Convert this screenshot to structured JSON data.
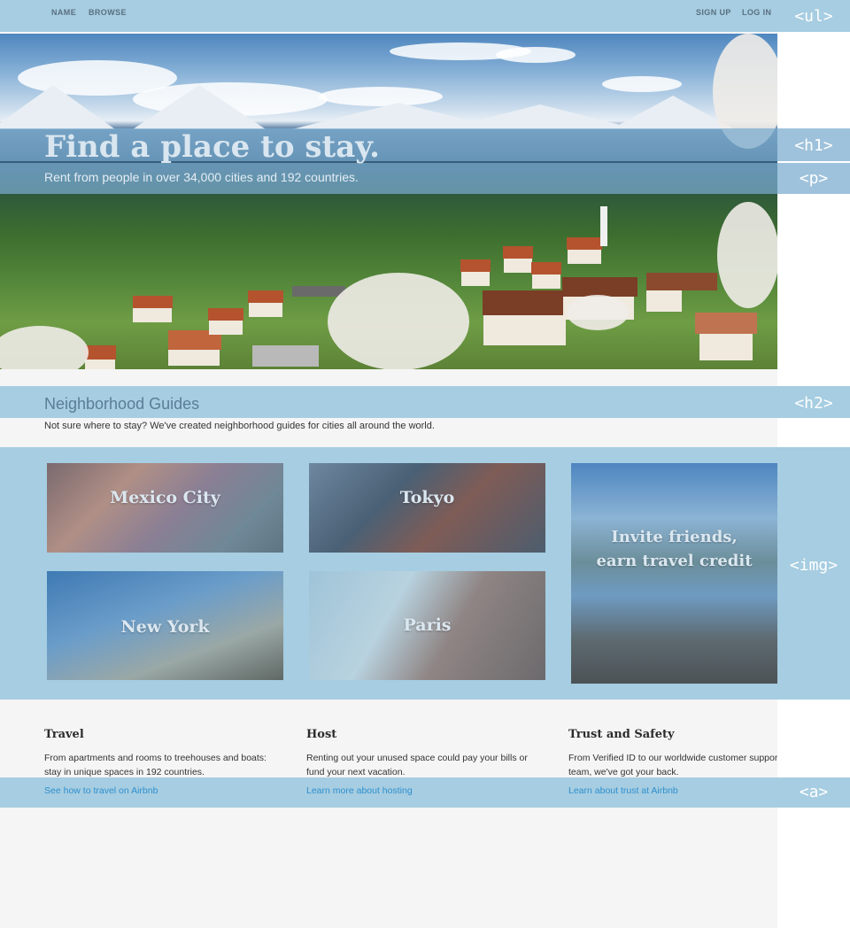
{
  "nav": {
    "left": [
      "NAME",
      "BROWSE"
    ],
    "right": [
      "SIGN UP",
      "LOG IN"
    ],
    "tag": "<ul>"
  },
  "hero": {
    "title": "Find a place to stay.",
    "subtitle": "Rent from people in over 34,000 cities and 192 countries.",
    "title_tag": "<h1>",
    "subtitle_tag": "<p>"
  },
  "neighborhoods": {
    "title": "Neighborhood Guides",
    "title_tag": "<h2>",
    "description": "Not sure where to stay? We've created neighborhood guides for cities all around the world.",
    "grid_tag": "<img>",
    "cards": [
      "Mexico City",
      "Tokyo",
      "New York",
      "Paris"
    ],
    "invite": [
      "Invite friends,",
      "earn travel credit"
    ]
  },
  "info": {
    "link_tag": "<a>",
    "columns": [
      {
        "title": "Travel",
        "text": "From apartments and rooms to treehouses and boats: stay in unique spaces in 192 countries.",
        "link": "See how to travel on Airbnb"
      },
      {
        "title": "Host",
        "text": "Renting out your unused space could pay your bills or fund your next vacation.",
        "link": "Learn more about hosting"
      },
      {
        "title": "Trust and Safety",
        "text": "From Verified ID to our worldwide customer support team, we've got your back.",
        "link": "Learn about trust at Airbnb"
      }
    ]
  },
  "colors": {
    "accent": "#a6cde1",
    "link": "#2e8fcf"
  }
}
